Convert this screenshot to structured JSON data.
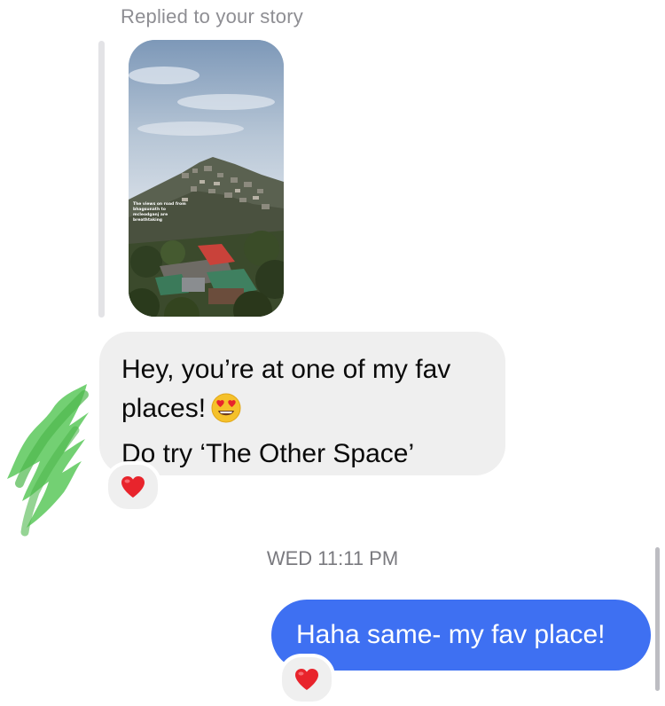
{
  "story_reply": {
    "label": "Replied to your story",
    "story_caption": "The views on road from bhagsunath to mcleodganj are breathtaking"
  },
  "incoming_message": {
    "line1": "Hey, you’re at one of my fav",
    "line2": "places!",
    "line2_emoji": "smiling-face-with-heart-eyes-icon",
    "line3": "Do try ‘The Other Space’",
    "reaction": "heart-icon"
  },
  "timestamp": "WED 11:11 PM",
  "outgoing_message": {
    "text": "Haha same- my fav place!",
    "reaction": "heart-icon"
  },
  "colors": {
    "incoming_bubble": "#efefef",
    "outgoing_bubble": "#3e70f2",
    "heart": "#e8242c",
    "scribble": "#5bc85a",
    "secondary_text": "#8e8e93"
  }
}
